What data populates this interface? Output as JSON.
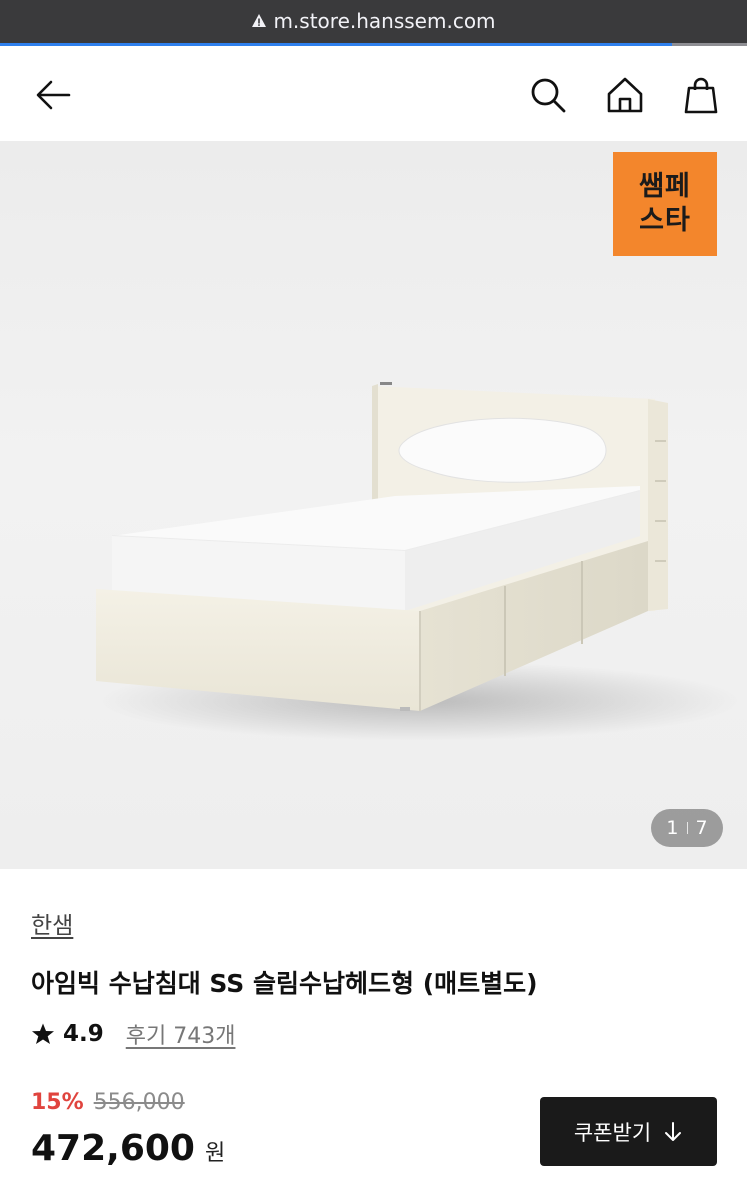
{
  "browser": {
    "url": "m.store.hanssem.com"
  },
  "header": {
    "icons": [
      "back-arrow-icon",
      "search-icon",
      "home-icon",
      "shopping-bag-icon"
    ]
  },
  "gallery": {
    "promo_line1": "쌤페",
    "promo_line2": "스타",
    "current": "1",
    "total": "7"
  },
  "product": {
    "brand": "한샘",
    "title": "아임빅 수납침대 SS 슬림수납헤드형 (매트별도)",
    "rating": "4.9",
    "reviews_label": "후기 743개",
    "discount": "15%",
    "original_price": "556,000",
    "price": "472,600",
    "currency": "원",
    "coupon_label": "쿠폰받기"
  },
  "colors": {
    "accent_orange": "#f3862c",
    "discount_red": "#e0443e",
    "dark_button": "#1a1a1a"
  }
}
